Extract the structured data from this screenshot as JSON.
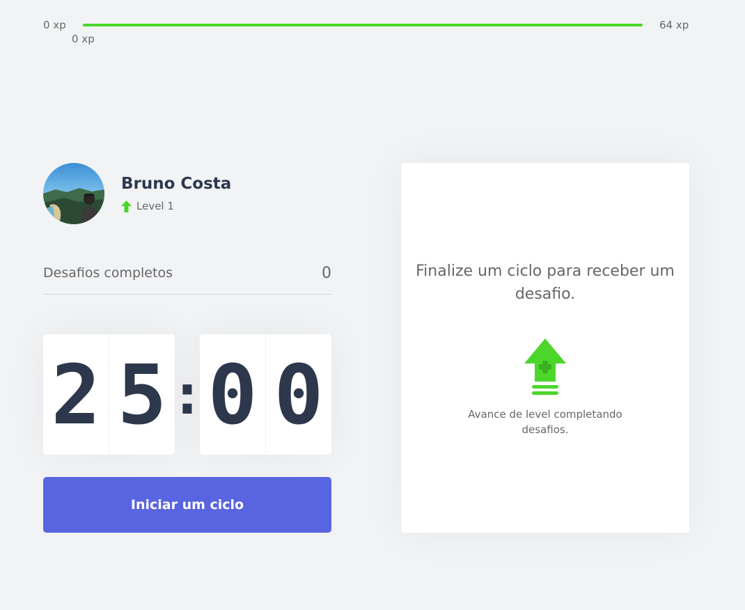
{
  "experience_bar": {
    "min_label": "0 xp",
    "max_label": "64 xp",
    "current_label": "0 xp",
    "progress_fraction": 1.0,
    "fill_color": "#4cd62b"
  },
  "profile": {
    "name": "Bruno Costa",
    "level_label": "Level 1",
    "level_icon": "level-up-arrow-icon"
  },
  "completed_challenges": {
    "label": "Desafios completos",
    "count": "0"
  },
  "countdown": {
    "minute_left": "2",
    "minute_right": "5",
    "separator": ":",
    "second_left": "0",
    "second_right": "0"
  },
  "start_button": {
    "label": "Iniciar um ciclo",
    "color": "#5965e0"
  },
  "challenge_box": {
    "title": "Finalize um ciclo para receber um desafio.",
    "icon": "level-up-icon",
    "hint": "Avance de level completando desafios."
  },
  "colors": {
    "background": "#f2f3f5",
    "accent_green": "#4cd62b",
    "title_text": "#2e384d",
    "body_text": "#666666"
  }
}
